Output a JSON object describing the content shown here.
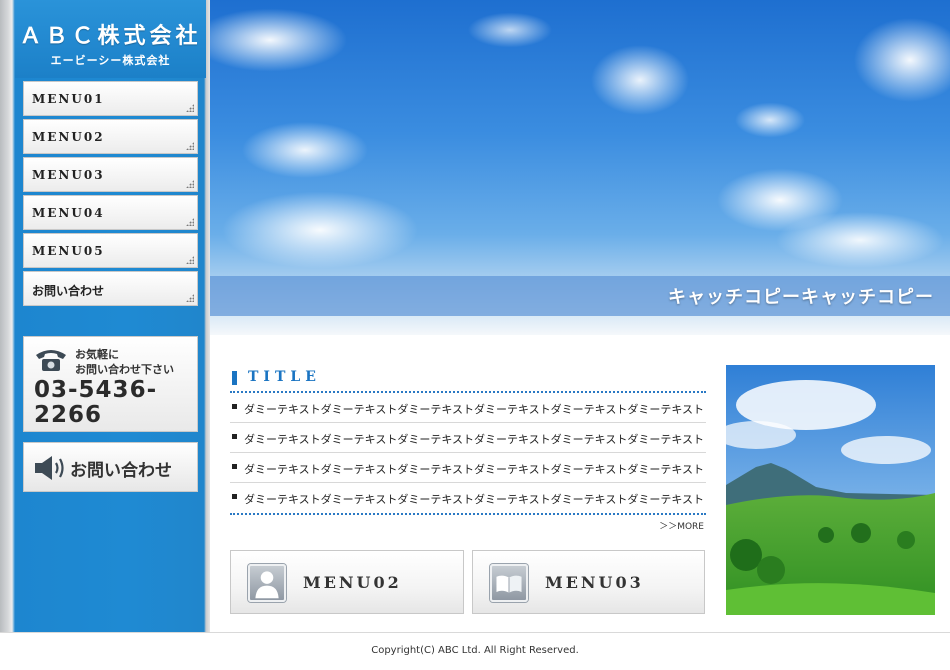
{
  "site": {
    "logo_title": "ＡＢＣ株式会社",
    "logo_subtitle": "エービーシー株式会社"
  },
  "sidebar": {
    "menu": [
      {
        "label": "MENU01"
      },
      {
        "label": "MENU02"
      },
      {
        "label": "MENU03"
      },
      {
        "label": "MENU04"
      },
      {
        "label": "MENU05"
      },
      {
        "label": "お問い合わせ"
      }
    ],
    "phone": {
      "line1": "お気軽に",
      "line2": "お問い合わせ下さい",
      "number": "03-5436-2266"
    },
    "contact_button": "お問い合わせ"
  },
  "hero": {
    "catch_copy": "キャッチコピーキャッチコピー"
  },
  "content": {
    "section_title": "TITLE",
    "news": [
      "ダミーテキストダミーテキストダミーテキストダミーテキストダミーテキストダミーテキスト",
      "ダミーテキストダミーテキストダミーテキストダミーテキストダミーテキストダミーテキスト",
      "ダミーテキストダミーテキストダミーテキストダミーテキストダミーテキストダミーテキスト",
      "ダミーテキストダミーテキストダミーテキストダミーテキストダミーテキストダミーテキスト"
    ],
    "more_link": "＞＞MORE",
    "tiles": [
      {
        "label": "MENU02",
        "icon": "person-icon"
      },
      {
        "label": "MENU03",
        "icon": "book-icon"
      }
    ]
  },
  "footer": {
    "copyright": "Copyright(C) ABC Ltd. All Right Reserved."
  },
  "colors": {
    "sidebar_blue": "#1f8ad3",
    "title_blue": "#1a74c2"
  }
}
